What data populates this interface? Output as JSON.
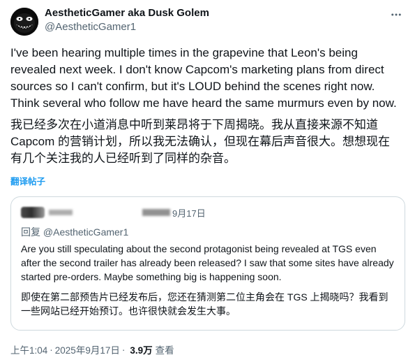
{
  "author": {
    "display_name": "AestheticGamer aka Dusk Golem",
    "handle": "@AestheticGamer1"
  },
  "post": {
    "text_en": "I've been hearing multiple times in the grapevine that Leon's being revealed next week. I don't know Capcom's marketing plans from direct sources so I can't confirm, but it's LOUD behind the scenes right now. Think several who follow me have heard the same murmurs even by now.",
    "text_zh": "我已经多次在小道消息中听到莱昂将于下周揭晓。我从直接来源不知道 Capcom 的营销计划，所以我无法确认，但现在幕后声音很大。想想现在有几个关注我的人已经听到了同样的杂音。",
    "translate_label": "翻译帖子",
    "time": "上午1:04",
    "date": "2025年9月17日",
    "views_count": "3.9万",
    "views_label": "查看"
  },
  "quote": {
    "date": "9月17日",
    "reply_to": "回复 @AestheticGamer1",
    "text_en": "Are you still speculating about the second protagonist being revealed at TGS even after the second trailer has already been released? I saw that some sites have already started pre-orders. Maybe something big is happening soon.",
    "text_zh": "即使在第二部预告片已经发布后，您还在猜测第二位主角会在 TGS 上揭晓吗？我看到一些网站已经开始预订。也许很快就会发生大事。"
  },
  "icons": {
    "more": "more-horizontal-icon",
    "avatar": "demon-face-avatar"
  },
  "colors": {
    "link": "#1d9bf0",
    "secondary_text": "#536471",
    "border": "#cfd9de"
  }
}
